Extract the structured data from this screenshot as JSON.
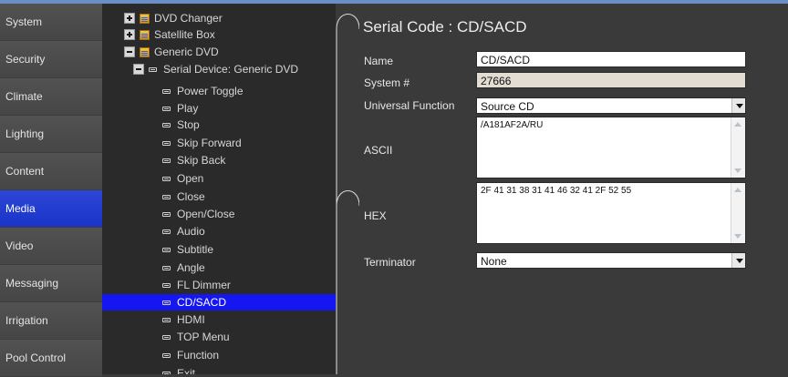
{
  "sidebar": {
    "items": [
      {
        "label": "System"
      },
      {
        "label": "Security"
      },
      {
        "label": "Climate"
      },
      {
        "label": "Lighting"
      },
      {
        "label": "Content"
      },
      {
        "label": "Media",
        "active": true
      },
      {
        "label": "Video"
      },
      {
        "label": "Messaging"
      },
      {
        "label": "Irrigation"
      },
      {
        "label": "Pool Control"
      }
    ]
  },
  "tree": {
    "nodes": [
      {
        "label": "DVD Changer",
        "expander": "plus",
        "icon": "folder-icon"
      },
      {
        "label": "Satellite Box",
        "expander": "plus",
        "icon": "folder-icon"
      },
      {
        "label": "Generic DVD",
        "expander": "minus",
        "icon": "folder-icon"
      },
      {
        "label": "Serial Device: Generic DVD",
        "expander": "minus",
        "icon": "device-icon"
      },
      {
        "label": "Power Toggle",
        "icon": "device-icon"
      },
      {
        "label": "Play",
        "icon": "device-icon"
      },
      {
        "label": "Stop",
        "icon": "device-icon"
      },
      {
        "label": "Skip Forward",
        "icon": "device-icon"
      },
      {
        "label": "Skip Back",
        "icon": "device-icon"
      },
      {
        "label": "Open",
        "icon": "device-icon"
      },
      {
        "label": "Close",
        "icon": "device-icon"
      },
      {
        "label": "Open/Close",
        "icon": "device-icon"
      },
      {
        "label": "Audio",
        "icon": "device-icon"
      },
      {
        "label": "Subtitle",
        "icon": "device-icon"
      },
      {
        "label": "Angle",
        "icon": "device-icon"
      },
      {
        "label": "FL Dimmer",
        "icon": "device-icon"
      },
      {
        "label": "CD/SACD",
        "icon": "device-icon",
        "selected": true
      },
      {
        "label": "HDMI",
        "icon": "device-icon"
      },
      {
        "label": "TOP Menu",
        "icon": "device-icon"
      },
      {
        "label": "Function",
        "icon": "device-icon"
      },
      {
        "label": "Exit",
        "icon": "device-icon"
      }
    ]
  },
  "detail": {
    "heading": "Serial Code : CD/SACD",
    "name_label": "Name",
    "name_value": "CD/SACD",
    "system_label": "System #",
    "system_value": "27666",
    "universal_label": "Universal Function",
    "universal_value": "Source CD",
    "ascii_label": "ASCII",
    "ascii_value": "/A181AF2A/RU",
    "hex_label": "HEX",
    "hex_value": "2F 41 31 38 31 41 46 32 41 2F 52 55",
    "terminator_label": "Terminator",
    "terminator_value": "None"
  },
  "colors": {
    "accent_active": "#1a34c8",
    "selection": "#1616f0",
    "top_line": "#6a8fc4"
  }
}
